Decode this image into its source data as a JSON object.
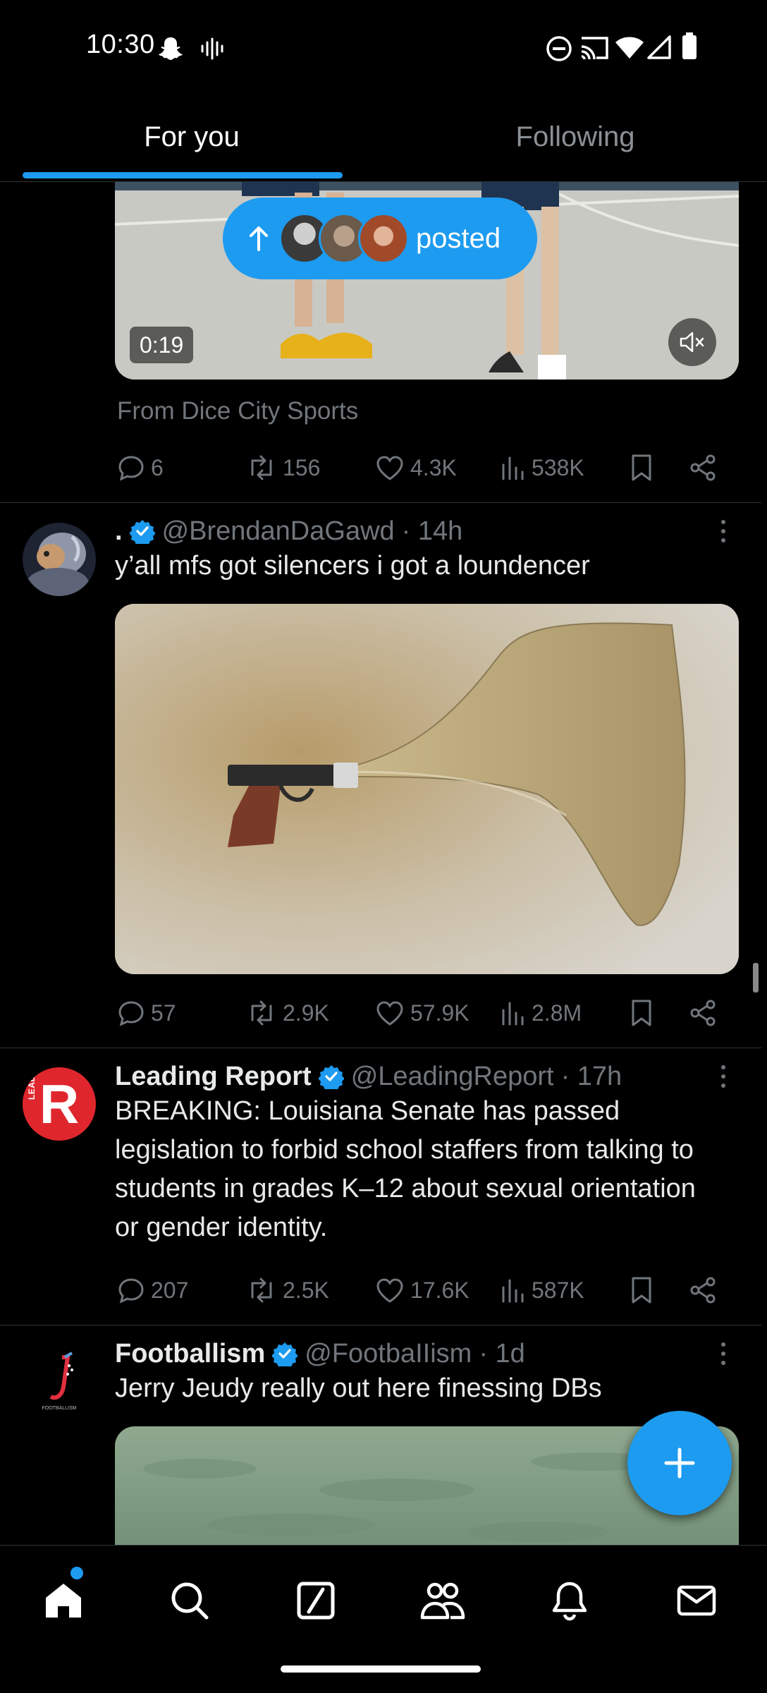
{
  "status_bar": {
    "time": "10:30",
    "left_icons": [
      "snapchat-icon",
      "voicemail-icon"
    ],
    "right_icons": [
      "do-not-disturb-icon",
      "cast-icon",
      "wifi-icon",
      "signal-icon",
      "battery-icon"
    ]
  },
  "tabs": [
    {
      "label": "For you",
      "active": true
    },
    {
      "label": "Following",
      "active": false
    }
  ],
  "new_posts_pill": {
    "label": "posted",
    "icon": "arrow-up-icon"
  },
  "video_post": {
    "duration": "0:19",
    "from_label": "From Dice City Sports",
    "actions": {
      "replies": "6",
      "reposts": "156",
      "likes": "4.3K",
      "views": "538K"
    }
  },
  "tweets": [
    {
      "name": ".",
      "verified": true,
      "handle": "@BrendanDaGawd",
      "time": "· 14h",
      "text": "y’all mfs got silencers i got a loundencer",
      "actions": {
        "replies": "57",
        "reposts": "2.9K",
        "likes": "57.9K",
        "views": "2.8M"
      }
    },
    {
      "name": "Leading Report",
      "verified": true,
      "handle": "@LeadingReport",
      "time": "· 17h",
      "text": "BREAKING: Louisiana Senate has passed legislation to forbid school staffers from talking to students in grades K–12 about sexual orientation or gender identity.",
      "avatar_text": "LEADING",
      "avatar_letter": "R",
      "actions": {
        "replies": "207",
        "reposts": "2.5K",
        "likes": "17.6K",
        "views": "587K"
      }
    },
    {
      "name": "Footballism",
      "verified": true,
      "handle": "@FootbaIIism",
      "time": "· 1d",
      "text": "Jerry Jeudy really out here finessing DBs",
      "avatar_text": "FOOTBALLISM"
    }
  ],
  "bottom_nav": [
    "home-icon",
    "search-icon",
    "grok-icon",
    "communities-icon",
    "notifications-icon",
    "messages-icon"
  ],
  "colors": {
    "accent": "#1d9bf0",
    "muted": "#71767b",
    "background": "#000000",
    "divider": "#2f3336"
  }
}
